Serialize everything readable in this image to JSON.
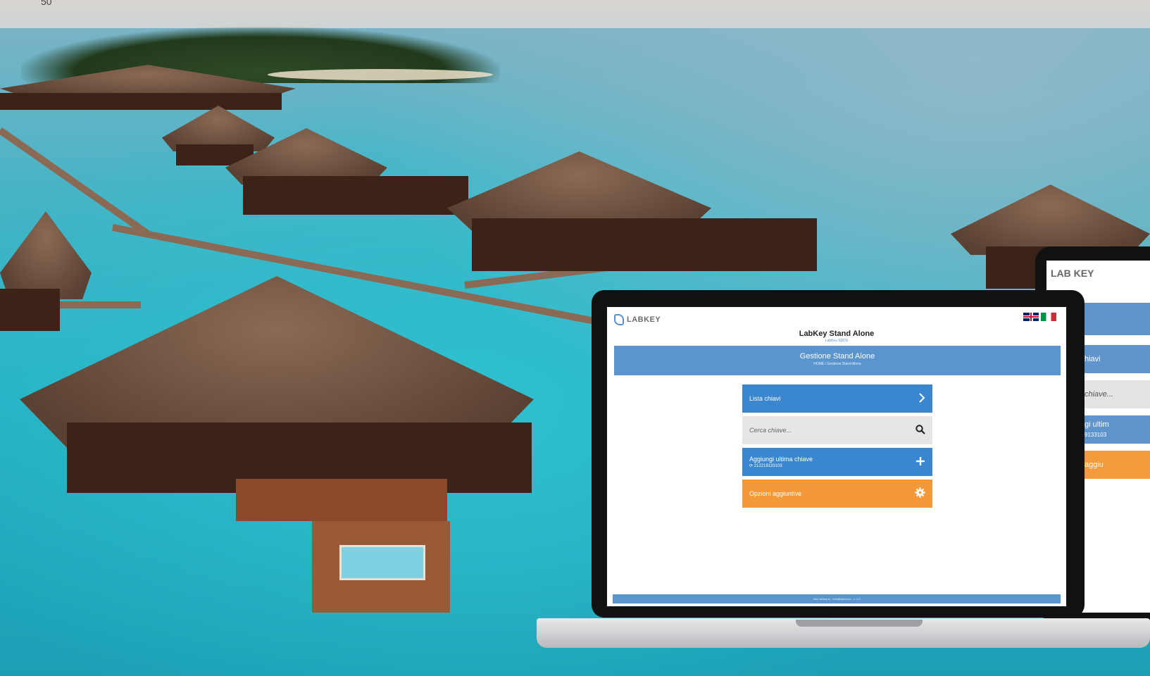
{
  "page_number": "50",
  "app": {
    "logo_text": "LABKEY",
    "title": "LabKey Stand Alone",
    "subtitle": "LabKey-SDDS",
    "banner_title": "Gestione Stand Alone",
    "breadcrumb": "HOME / Gestione Stand Alone",
    "menu": {
      "keys_list": "Lista chiavi",
      "search_placeholder": "Cerca chiave...",
      "add_last_key": "Aggiungi ultima chiave",
      "last_key_code": "212219133103",
      "options": "Opzioni aggiuntive"
    },
    "footer": "Info: labkey.io - info@labkey.io - v. 1.0",
    "languages": [
      "en",
      "it"
    ]
  },
  "tablet": {
    "logo_text": "LAB KEY",
    "items": [
      "hiavi",
      "chiave...",
      "gi ultim",
      "aggiu"
    ],
    "item_code": "9133103"
  },
  "colors": {
    "banner": "#5b95d0",
    "menu_blue": "#3a86cf",
    "menu_orange": "#f3993a",
    "menu_gray": "#e6e6e6"
  },
  "icons": {
    "keys_list": "chevron-right-icon",
    "search": "search-icon",
    "add": "plus-icon",
    "options": "gear-icon",
    "refresh": "refresh-icon"
  }
}
